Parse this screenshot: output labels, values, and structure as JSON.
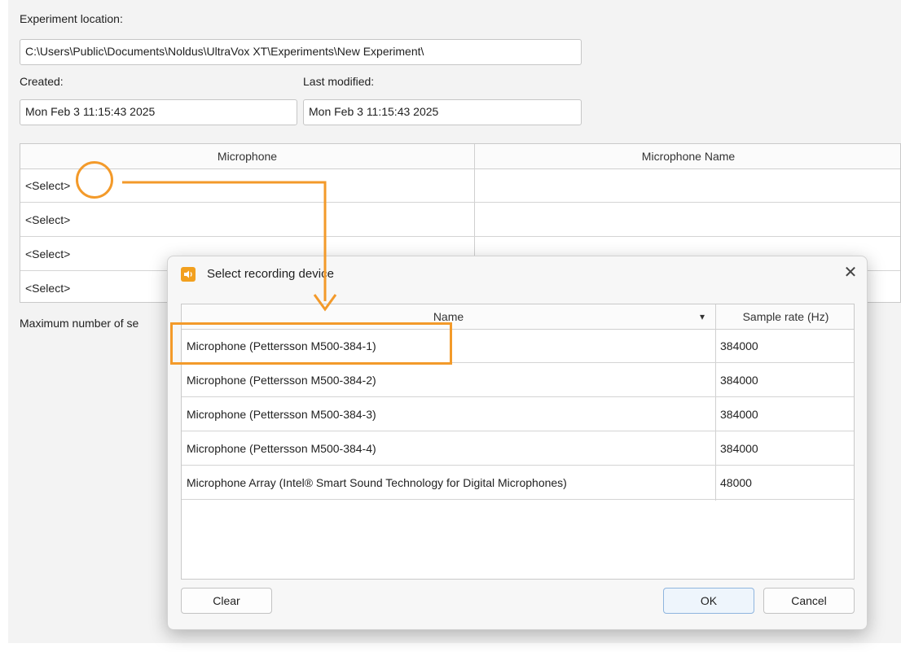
{
  "experiment": {
    "location_label": "Experiment location:",
    "location_value": "C:\\Users\\Public\\Documents\\Noldus\\UltraVox XT\\Experiments\\New Experiment\\",
    "created_label": "Created:",
    "created_value": "Mon Feb 3 11:15:43 2025",
    "modified_label": "Last modified:",
    "modified_value": "Mon Feb 3 11:15:43 2025"
  },
  "mic_table": {
    "headers": [
      "Microphone",
      "Microphone Name"
    ],
    "rows": [
      "<Select>",
      "<Select>",
      "<Select>",
      "<Select>"
    ]
  },
  "max_sessions_label": "Maximum number of se",
  "dialog": {
    "title": "Select recording device",
    "close_glyph": "✕",
    "col_name": "Name",
    "col_rate": "Sample rate (Hz)",
    "sort_glyph": "▾",
    "rows": [
      {
        "name": "Microphone (Pettersson M500-384-1)",
        "rate": "384000"
      },
      {
        "name": "Microphone (Pettersson M500-384-2)",
        "rate": "384000"
      },
      {
        "name": "Microphone (Pettersson M500-384-3)",
        "rate": "384000"
      },
      {
        "name": "Microphone (Pettersson M500-384-4)",
        "rate": "384000"
      },
      {
        "name": "Microphone Array (Intel® Smart Sound Technology for Digital Microphones)",
        "rate": "48000"
      }
    ],
    "clear_label": "Clear",
    "ok_label": "OK",
    "cancel_label": "Cancel",
    "icon": "speaker-icon"
  },
  "colors": {
    "annotation": "#f39a2a",
    "icon": "#f2a01e"
  }
}
